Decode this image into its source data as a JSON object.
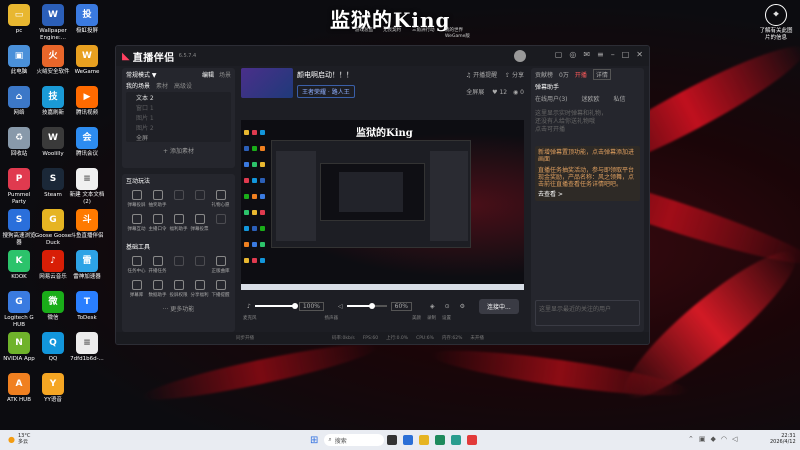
{
  "desktop": {
    "left_col1": [
      {
        "label": "pc",
        "color": "#e8b730",
        "glyph": "▭"
      },
      {
        "label": "此电脑",
        "color": "#4a90d9",
        "glyph": "▣"
      },
      {
        "label": "网络",
        "color": "#3c78c8",
        "glyph": "⌂"
      },
      {
        "label": "回收站",
        "color": "#8899aa",
        "glyph": "♻"
      },
      {
        "label": "Pummel Party",
        "color": "#e03a4f",
        "glyph": "P"
      },
      {
        "label": "搜狗高速浏览器",
        "color": "#2a6fdb",
        "glyph": "S"
      },
      {
        "label": "KOOK",
        "color": "#2cc36b",
        "glyph": "K"
      },
      {
        "label": "Logitech G HUB",
        "color": "#3a7be0",
        "glyph": "G"
      },
      {
        "label": "NVIDIA App",
        "color": "#6fb32b",
        "glyph": "N"
      },
      {
        "label": "ATK HUB",
        "color": "#f08020",
        "glyph": "A"
      }
    ],
    "left_col2": [
      {
        "label": "Wallpaper Engine:...",
        "color": "#2b5fb8",
        "glyph": "W"
      },
      {
        "label": "火绒安全软件",
        "color": "#e8662a",
        "glyph": "火"
      },
      {
        "label": "技嘉刷新",
        "color": "#1a9ad6",
        "glyph": "技"
      },
      {
        "label": "Woolilly",
        "color": "#3a3a3a",
        "glyph": "W"
      },
      {
        "label": "Steam",
        "color": "#1b2838",
        "glyph": "S"
      },
      {
        "label": "Goose Goose Duck",
        "color": "#e6b422",
        "glyph": "G"
      },
      {
        "label": "网易云音乐",
        "color": "#d81e06",
        "glyph": "♪"
      },
      {
        "label": "微信",
        "color": "#1aad19",
        "glyph": "微"
      },
      {
        "label": "QQ",
        "color": "#1296db",
        "glyph": "Q"
      },
      {
        "label": "YY语音",
        "color": "#f5a623",
        "glyph": "Y"
      }
    ],
    "left_col3": [
      {
        "label": "极虹投屏",
        "color": "#3a7ae0",
        "glyph": "投"
      },
      {
        "label": "WeGame",
        "color": "#e8a020",
        "glyph": "W"
      },
      {
        "label": "腾讯视频",
        "color": "#ff6a00",
        "glyph": "▶"
      },
      {
        "label": "腾讯会议",
        "color": "#2d8cf0",
        "glyph": "会"
      },
      {
        "label": "新建 文本文档 (2)",
        "color": "#f0f0f0",
        "glyph": "≡"
      },
      {
        "label": "斗鱼直播伴侣",
        "color": "#ff7a00",
        "glyph": "斗"
      },
      {
        "label": "雷神加速器",
        "color": "#2da3e6",
        "glyph": "雷"
      },
      {
        "label": "ToDesk",
        "color": "#2a7fff",
        "glyph": "T"
      },
      {
        "label": "7dfd1b6d-...",
        "color": "#ececec",
        "glyph": "≡"
      }
    ],
    "right_icon": {
      "label": "了解有关此图片的信息",
      "glyph": "⌖"
    }
  },
  "wallpaper_title": {
    "text": "监狱的King",
    "subs": [
      "游戏总监",
      "无畏契约",
      "三角洲行动",
      "我的世界"
    ],
    "wegame": "WeGame版"
  },
  "app": {
    "name": "直播伴侣",
    "version": "6.5.7.4",
    "scene_mode": "常规模式 ▼",
    "edit_label": "编辑",
    "scene_btn": "场景",
    "my_scenes_tabs": [
      "我的场景",
      "素材",
      "高级设"
    ],
    "sources": [
      "文本 2",
      "窗口 1",
      "图片 1",
      "图片 2",
      "全屏"
    ],
    "add_source": "+ 添加素材",
    "interact_title": "互动玩法",
    "interact_items": [
      "弹幕投屏",
      "抽奖助手",
      "",
      "",
      "礼物心愿",
      "弹幕互动",
      "主播口令",
      "福利助手",
      "弹幕投票",
      ""
    ],
    "tools_title": "基础工具",
    "tools_items": [
      "任务中心",
      "开播任务",
      "",
      "",
      "正版曲库",
      "弹幕库",
      "数据助手",
      "投屏权限",
      "分享福利",
      "下播提醒"
    ],
    "more": "··· 更多功能",
    "stream_title": "颜电啊启动！！！",
    "category": "王者荣耀 · 路人王",
    "open_notify": "开播提醒",
    "share": "分享",
    "full_screen": "全屏展",
    "likes": "12",
    "views": "0",
    "mic_label": "麦克风",
    "mic_vol": "100%",
    "speaker_label": "扬声器",
    "spk_vol": "60%",
    "ctrl_labels": [
      "美颜",
      "录制",
      "设置"
    ],
    "live_btn": "连接中...",
    "right_tabs": [
      "贡献榜",
      "0万",
      "开播",
      "详情"
    ],
    "assistant_title": "弹幕助手",
    "assistant_tabs": [
      "在线用户(3)",
      "迷欧欧",
      "私信"
    ],
    "assistant_notes": [
      "这里显示实时弹幕和礼物，",
      "还没有人给你送礼物哦",
      "点击可开播"
    ],
    "promo": "新增弹幕置顶功能，点击弹幕添加进画面",
    "task": "直播任务抽奖活动，参与即领取平台现金奖励，产品名称：风之领舞，点击前往直播查看任务详情吧吧。",
    "promo_link": "去查看 >",
    "empty_note": "这里显示最近的关注的用户",
    "status_items": [
      "同步开播",
      "码率:0kb/s",
      "FPS:60",
      "上行:0.0%",
      "CPU:6%",
      "内存:62%",
      "未开播"
    ]
  },
  "taskbar": {
    "weather": "13°C",
    "weather_desc": "多云",
    "search": "搜索",
    "time": "22:31",
    "date": "2026/4/12"
  }
}
